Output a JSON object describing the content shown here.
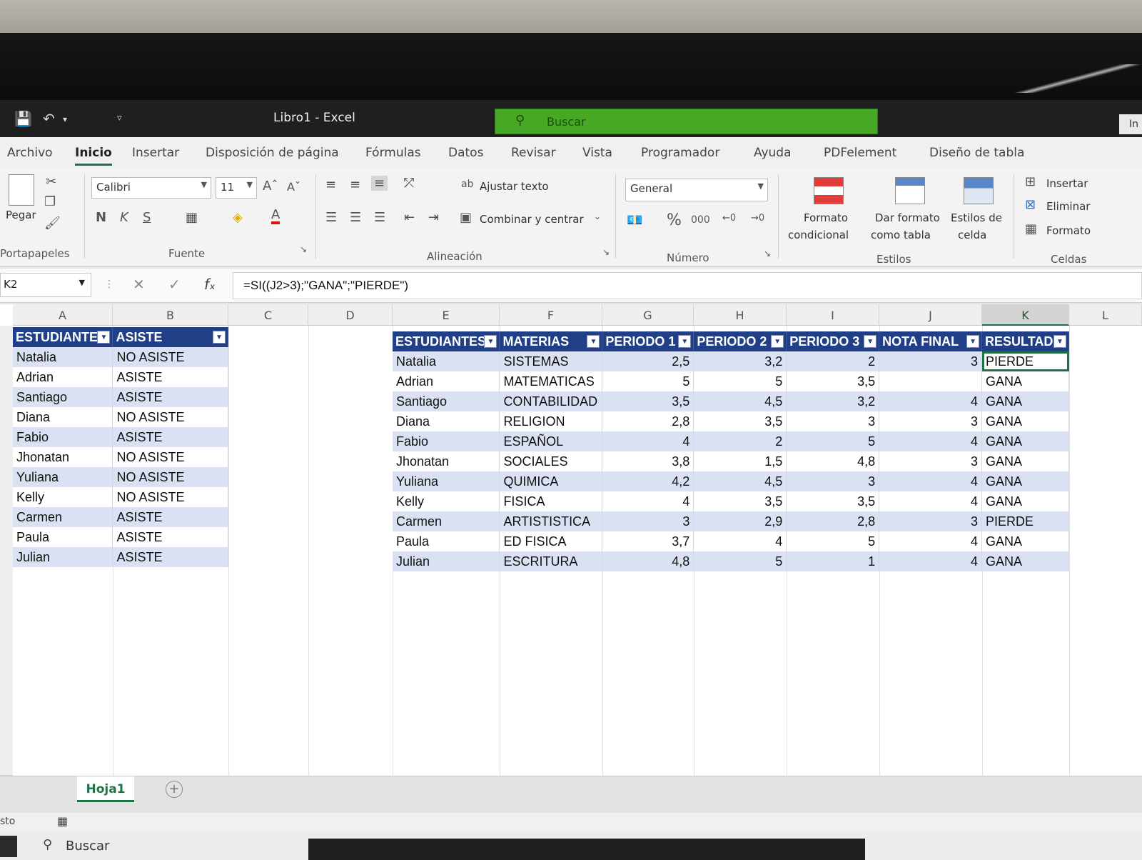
{
  "window": {
    "title": "Libro1  -  Excel",
    "search_placeholder": "Buscar",
    "user_label": "In"
  },
  "tabs": [
    "Archivo",
    "Inicio",
    "Insertar",
    "Disposición de página",
    "Fórmulas",
    "Datos",
    "Revisar",
    "Vista",
    "Programador",
    "Ayuda",
    "PDFelement",
    "Diseño de tabla"
  ],
  "active_tab": "Inicio",
  "ribbon": {
    "clipboard": {
      "paste": "Pegar",
      "group": "Portapapeles"
    },
    "font": {
      "name": "Calibri",
      "size": "11",
      "bold": "N",
      "italic": "K",
      "underline": "S",
      "group": "Fuente"
    },
    "alignment": {
      "wrap": "Ajustar texto",
      "merge": "Combinar y centrar",
      "group": "Alineación"
    },
    "number": {
      "format": "General",
      "group": "Número"
    },
    "styles": {
      "conditional_1": "Formato",
      "conditional_2": "condicional",
      "as_table_1": "Dar formato",
      "as_table_2": "como tabla",
      "cell_styles_1": "Estilos de",
      "cell_styles_2": "celda",
      "group": "Estilos"
    },
    "cells": {
      "insert": "Insertar",
      "delete": "Eliminar",
      "format": "Formato",
      "group": "Celdas"
    }
  },
  "formula_bar": {
    "name_box": "K2",
    "formula": "=SI((J2>3);\"GANA\";\"PIERDE\")"
  },
  "columns": [
    "A",
    "B",
    "C",
    "D",
    "E",
    "F",
    "G",
    "H",
    "I",
    "J",
    "K",
    "L"
  ],
  "table1": {
    "headers": [
      "ESTUDIANTES",
      "ASISTE"
    ],
    "rows": [
      [
        "Natalia",
        "NO ASISTE"
      ],
      [
        "Adrian",
        "ASISTE"
      ],
      [
        "Santiago",
        "ASISTE"
      ],
      [
        "Diana",
        "NO ASISTE"
      ],
      [
        "Fabio",
        "ASISTE"
      ],
      [
        "Jhonatan",
        "NO ASISTE"
      ],
      [
        "Yuliana",
        "NO ASISTE"
      ],
      [
        "Kelly",
        "NO ASISTE"
      ],
      [
        "Carmen",
        "ASISTE"
      ],
      [
        "Paula",
        "ASISTE"
      ],
      [
        "Julian",
        "ASISTE"
      ]
    ]
  },
  "table2": {
    "headers": [
      "ESTUDIANTES",
      "MATERIAS",
      "PERIODO 1",
      "PERIODO 2",
      "PERIODO 3",
      "NOTA FINAL",
      "RESULTAD"
    ],
    "rows": [
      [
        "Natalia",
        "SISTEMAS",
        "2,5",
        "3,2",
        "2",
        "3",
        "PIERDE"
      ],
      [
        "Adrian",
        "MATEMATICAS",
        "5",
        "5",
        "3,5",
        "",
        "GANA"
      ],
      [
        "Santiago",
        "CONTABILIDAD",
        "3,5",
        "4,5",
        "3,2",
        "4",
        "GANA"
      ],
      [
        "Diana",
        "RELIGION",
        "2,8",
        "3,5",
        "3",
        "3",
        "GANA"
      ],
      [
        "Fabio",
        "ESPAÑOL",
        "4",
        "2",
        "5",
        "4",
        "GANA"
      ],
      [
        "Jhonatan",
        "SOCIALES",
        "3,8",
        "1,5",
        "4,8",
        "3",
        "GANA"
      ],
      [
        "Yuliana",
        "QUIMICA",
        "4,2",
        "4,5",
        "3",
        "4",
        "GANA"
      ],
      [
        "Kelly",
        "FISICA",
        "4",
        "3,5",
        "3,5",
        "4",
        "GANA"
      ],
      [
        "Carmen",
        "ARTISTISTICA",
        "3",
        "2,9",
        "2,8",
        "3",
        "PIERDE"
      ],
      [
        "Paula",
        "ED FISICA",
        "3,7",
        "4",
        "5",
        "4",
        "GANA"
      ],
      [
        "Julian",
        "ESCRITURA",
        "4,8",
        "5",
        "1",
        "4",
        "GANA"
      ]
    ]
  },
  "sheet": {
    "tab": "Hoja1"
  },
  "statusbar": {
    "left": "sto"
  },
  "taskbar": {
    "search": "Buscar"
  },
  "colors": {
    "accent": "#217346",
    "table_header": "#203f86",
    "band": "#d9e1f2",
    "search_bg": "#46a825"
  }
}
